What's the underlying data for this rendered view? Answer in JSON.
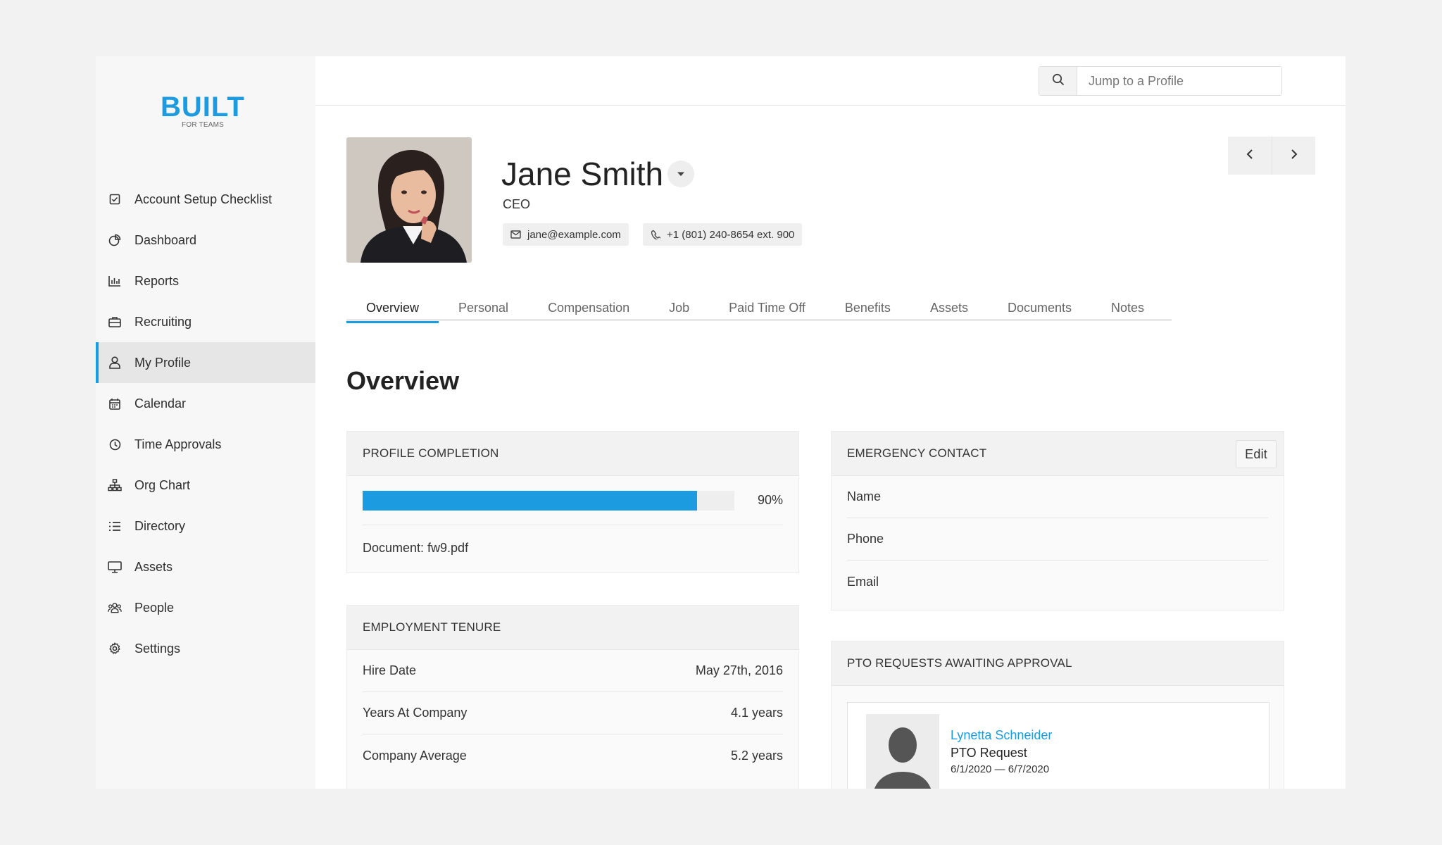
{
  "brand": {
    "logo_text": "BUILT",
    "logo_sub": "FOR TEAMS",
    "accent": "#1c9be0"
  },
  "sidebar": {
    "items": [
      {
        "label": "Account Setup Checklist",
        "icon": "checkbox-icon"
      },
      {
        "label": "Dashboard",
        "icon": "pie-chart-icon"
      },
      {
        "label": "Reports",
        "icon": "bar-chart-icon"
      },
      {
        "label": "Recruiting",
        "icon": "briefcase-icon"
      },
      {
        "label": "My Profile",
        "icon": "user-icon",
        "active": true
      },
      {
        "label": "Calendar",
        "icon": "calendar-icon"
      },
      {
        "label": "Time Approvals",
        "icon": "clock-icon"
      },
      {
        "label": "Org Chart",
        "icon": "org-chart-icon"
      },
      {
        "label": "Directory",
        "icon": "list-icon"
      },
      {
        "label": "Assets",
        "icon": "monitor-icon"
      },
      {
        "label": "People",
        "icon": "people-icon"
      },
      {
        "label": "Settings",
        "icon": "gear-icon"
      }
    ]
  },
  "topbar": {
    "search_placeholder": "Jump to a Profile"
  },
  "profile": {
    "name": "Jane Smith",
    "title": "CEO",
    "email": "jane@example.com",
    "phone": "+1 (801) 240-8654 ext. 900"
  },
  "tabs": [
    "Overview",
    "Personal",
    "Compensation",
    "Job",
    "Paid Time Off",
    "Benefits",
    "Assets",
    "Documents",
    "Notes"
  ],
  "overview": {
    "title": "Overview",
    "profile_completion": {
      "header": "PROFILE COMPLETION",
      "percent_label": "90%",
      "percent": 0.9,
      "document_label": "Document: fw9.pdf"
    },
    "employment_tenure": {
      "header": "EMPLOYMENT TENURE",
      "rows": [
        {
          "label": "Hire Date",
          "value": "May 27th, 2016"
        },
        {
          "label": "Years At Company",
          "value": "4.1 years"
        },
        {
          "label": "Company Average",
          "value": "5.2 years"
        }
      ]
    },
    "emergency_contact": {
      "header": "EMERGENCY CONTACT",
      "edit_label": "Edit",
      "fields": [
        "Name",
        "Phone",
        "Email"
      ]
    },
    "pto": {
      "header": "PTO REQUESTS AWAITING APPROVAL",
      "request": {
        "name": "Lynetta Schneider",
        "type": "PTO Request",
        "dates": "6/1/2020 — 6/7/2020"
      }
    }
  }
}
